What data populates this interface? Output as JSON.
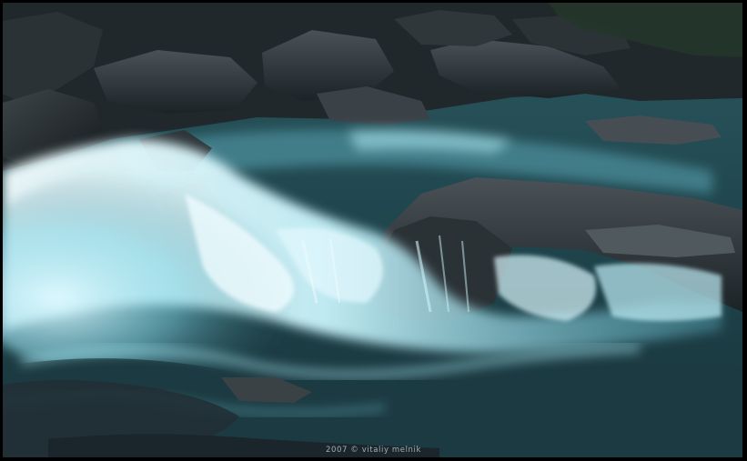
{
  "photo": {
    "subject": "long-exposure-river-rapids",
    "credit": "2007 © vitaliy melnik"
  },
  "colors": {
    "frame": "#000000",
    "rock_dark": "#1e262b",
    "rock_mid": "#3a4248",
    "water_deep": "#1f4a52",
    "water_foam": "#e8fbff",
    "water_glow": "#9fe6f5"
  }
}
